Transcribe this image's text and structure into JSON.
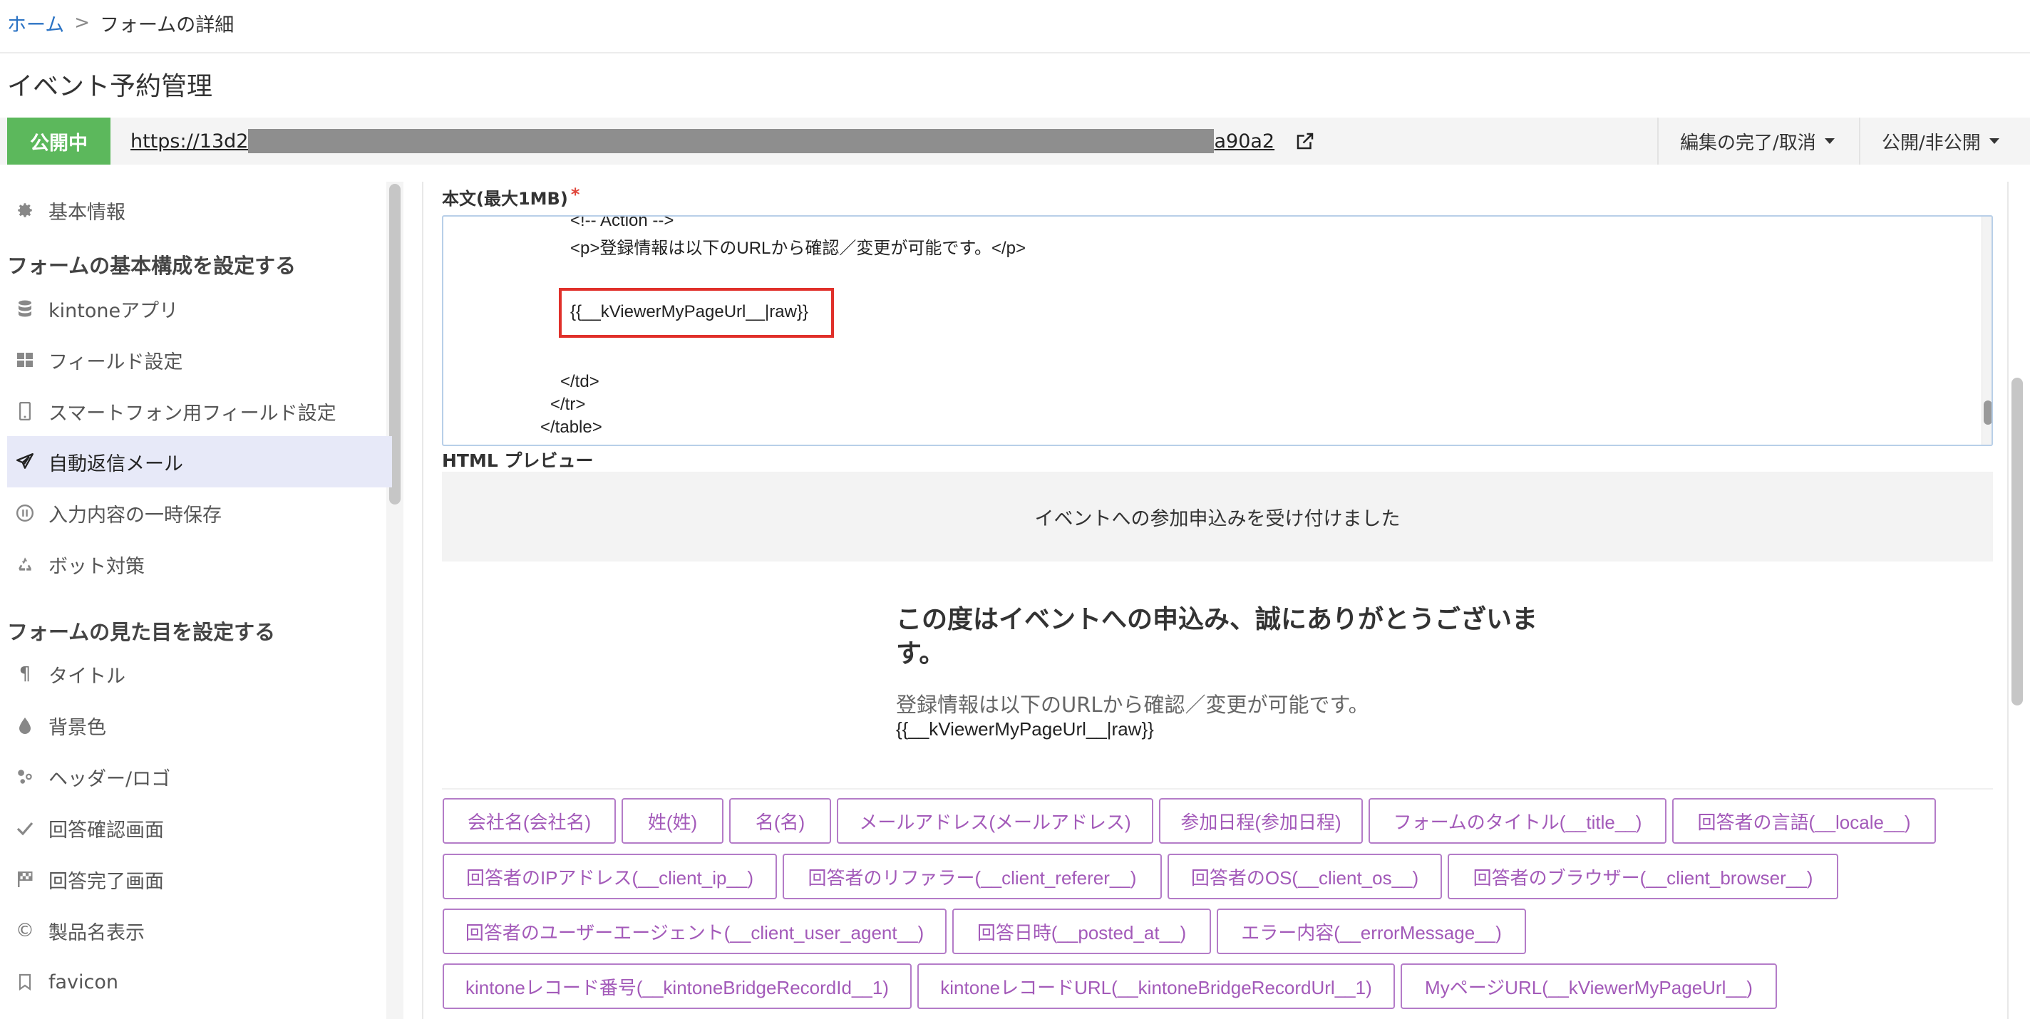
{
  "breadcrumb": {
    "home": "ホーム",
    "separator": ">",
    "current": "フォームの詳細"
  },
  "page_title": "イベント予約管理",
  "header": {
    "status": "公開中",
    "url_visible_start": "https://13d2",
    "url_visible_end": "a90a2",
    "edit_button": "編集の完了/取消",
    "publish_button": "公開/非公開"
  },
  "sidebar": {
    "basic_info": "基本情報",
    "section1": "フォームの基本構成を設定する",
    "items1": [
      "kintoneアプリ",
      "フィールド設定",
      "スマートフォン用フィールド設定",
      "自動返信メール",
      "入力内容の一時保存",
      "ボット対策"
    ],
    "section2": "フォームの見た目を設定する",
    "items2": [
      "タイトル",
      "背景色",
      "ヘッダー/ロゴ",
      "回答確認画面",
      "回答完了画面",
      "製品名表示",
      "favicon"
    ]
  },
  "editor": {
    "label": "本文(最大1MB)",
    "required_mark": "*",
    "lines": [
      "<!-- Action -->",
      "<p>登録情報は以下のURLから確認／変更が可能です。</p>",
      "{{__kViewerMyPageUrl__|raw}}",
      "</td>",
      "</tr>",
      "</table>"
    ]
  },
  "preview": {
    "label": "HTML プレビュー",
    "banner": "イベントへの参加申込みを受け付けました",
    "heading_line1": "この度はイベントへの申込み、誠にありがとうございま",
    "heading_line2": "す。",
    "text": "登録情報は以下のURLから確認／変更が可能です。",
    "url": "{{__kViewerMyPageUrl__|raw}}"
  },
  "tags": [
    "会社名(会社名)",
    "姓(姓)",
    "名(名)",
    "メールアドレス(メールアドレス)",
    "参加日程(参加日程)",
    "フォームのタイトル(__title__)",
    "回答者の言語(__locale__)",
    "回答者のIPアドレス(__client_ip__)",
    "回答者のリファラー(__client_referer__)",
    "回答者のOS(__client_os__)",
    "回答者のブラウザー(__client_browser__)",
    "回答者のユーザーエージェント(__client_user_agent__)",
    "回答日時(__posted_at__)",
    "エラー内容(__errorMessage__)",
    "kintoneレコード番号(__kintoneBridgeRecordId__1)",
    "kintoneレコードURL(__kintoneBridgeRecordUrl__1)",
    "MyページURL(__kViewerMyPageUrl__)"
  ],
  "colors": {
    "status_green": "#5cb85c",
    "tag_purple": "#a35ab9",
    "highlight_red": "#e0302a",
    "link_blue": "#2b73c4",
    "active_bg": "#e7e9f8"
  }
}
